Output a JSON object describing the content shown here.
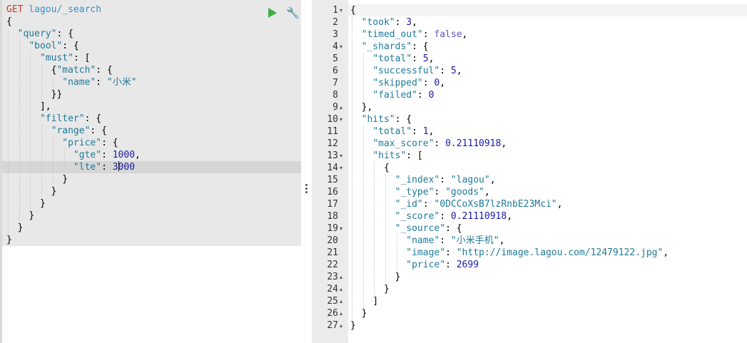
{
  "request": {
    "method": "GET",
    "path": "lagou/_search",
    "lines": [
      {
        "indent": 0,
        "tokens": [
          [
            "pun",
            "{"
          ]
        ]
      },
      {
        "indent": 1,
        "tokens": [
          [
            "key",
            "\"query\""
          ],
          [
            "pun",
            ": {"
          ]
        ]
      },
      {
        "indent": 2,
        "tokens": [
          [
            "key",
            "\"bool\""
          ],
          [
            "pun",
            ": {"
          ]
        ]
      },
      {
        "indent": 3,
        "tokens": [
          [
            "key",
            "\"must\""
          ],
          [
            "pun",
            ": ["
          ]
        ]
      },
      {
        "indent": 4,
        "tokens": [
          [
            "pun",
            "{"
          ],
          [
            "key",
            "\"match\""
          ],
          [
            "pun",
            ": {"
          ]
        ]
      },
      {
        "indent": 5,
        "tokens": [
          [
            "key",
            "\"name\""
          ],
          [
            "pun",
            ": "
          ],
          [
            "str",
            "\"小米\""
          ]
        ]
      },
      {
        "indent": 4,
        "tokens": [
          [
            "pun",
            "}}"
          ]
        ]
      },
      {
        "indent": 3,
        "tokens": [
          [
            "pun",
            "],"
          ]
        ]
      },
      {
        "indent": 3,
        "tokens": [
          [
            "key",
            "\"filter\""
          ],
          [
            "pun",
            ": {"
          ]
        ]
      },
      {
        "indent": 4,
        "tokens": [
          [
            "key",
            "\"range\""
          ],
          [
            "pun",
            ": {"
          ]
        ]
      },
      {
        "indent": 5,
        "tokens": [
          [
            "key",
            "\"price\""
          ],
          [
            "pun",
            ": {"
          ]
        ]
      },
      {
        "indent": 6,
        "tokens": [
          [
            "key",
            "\"gte\""
          ],
          [
            "pun",
            ": "
          ],
          [
            "num",
            "1000"
          ],
          [
            "pun",
            ","
          ]
        ]
      },
      {
        "indent": 6,
        "tokens": [
          [
            "key",
            "\"lte\""
          ],
          [
            "pun",
            ": "
          ],
          [
            "num",
            "3"
          ],
          [
            "caret",
            ""
          ],
          [
            "num",
            "000"
          ]
        ],
        "active": true
      },
      {
        "indent": 5,
        "tokens": [
          [
            "pun",
            "}"
          ]
        ]
      },
      {
        "indent": 4,
        "tokens": [
          [
            "pun",
            "}"
          ]
        ]
      },
      {
        "indent": 3,
        "tokens": [
          [
            "pun",
            "}"
          ]
        ]
      },
      {
        "indent": 2,
        "tokens": [
          [
            "pun",
            "}"
          ]
        ]
      },
      {
        "indent": 1,
        "tokens": [
          [
            "pun",
            "}"
          ]
        ]
      },
      {
        "indent": 0,
        "tokens": [
          [
            "pun",
            "}"
          ]
        ]
      }
    ]
  },
  "toolbar": {
    "run_icon": "play-icon",
    "settings_icon": "wrench-icon",
    "wrench_glyph": "🔧"
  },
  "response": {
    "lines": [
      {
        "n": "1",
        "fold": "▾",
        "indent": 0,
        "tokens": [
          [
            "pun",
            "{"
          ]
        ]
      },
      {
        "n": "2",
        "fold": "",
        "indent": 1,
        "tokens": [
          [
            "key",
            "\"took\""
          ],
          [
            "pun",
            ": "
          ],
          [
            "num",
            "3"
          ],
          [
            "pun",
            ","
          ]
        ]
      },
      {
        "n": "3",
        "fold": "",
        "indent": 1,
        "tokens": [
          [
            "key",
            "\"timed_out\""
          ],
          [
            "pun",
            ": "
          ],
          [
            "bool",
            "false"
          ],
          [
            "pun",
            ","
          ]
        ]
      },
      {
        "n": "4",
        "fold": "▾",
        "indent": 1,
        "tokens": [
          [
            "key",
            "\"_shards\""
          ],
          [
            "pun",
            ": {"
          ]
        ]
      },
      {
        "n": "5",
        "fold": "",
        "indent": 2,
        "tokens": [
          [
            "key",
            "\"total\""
          ],
          [
            "pun",
            ": "
          ],
          [
            "num",
            "5"
          ],
          [
            "pun",
            ","
          ]
        ]
      },
      {
        "n": "6",
        "fold": "",
        "indent": 2,
        "tokens": [
          [
            "key",
            "\"successful\""
          ],
          [
            "pun",
            ": "
          ],
          [
            "num",
            "5"
          ],
          [
            "pun",
            ","
          ]
        ]
      },
      {
        "n": "7",
        "fold": "",
        "indent": 2,
        "tokens": [
          [
            "key",
            "\"skipped\""
          ],
          [
            "pun",
            ": "
          ],
          [
            "num",
            "0"
          ],
          [
            "pun",
            ","
          ]
        ]
      },
      {
        "n": "8",
        "fold": "",
        "indent": 2,
        "tokens": [
          [
            "key",
            "\"failed\""
          ],
          [
            "pun",
            ": "
          ],
          [
            "num",
            "0"
          ]
        ]
      },
      {
        "n": "9",
        "fold": "▴",
        "indent": 1,
        "tokens": [
          [
            "pun",
            "},"
          ]
        ]
      },
      {
        "n": "10",
        "fold": "▾",
        "indent": 1,
        "tokens": [
          [
            "key",
            "\"hits\""
          ],
          [
            "pun",
            ": {"
          ]
        ]
      },
      {
        "n": "11",
        "fold": "",
        "indent": 2,
        "tokens": [
          [
            "key",
            "\"total\""
          ],
          [
            "pun",
            ": "
          ],
          [
            "num",
            "1"
          ],
          [
            "pun",
            ","
          ]
        ]
      },
      {
        "n": "12",
        "fold": "",
        "indent": 2,
        "tokens": [
          [
            "key",
            "\"max_score\""
          ],
          [
            "pun",
            ": "
          ],
          [
            "num",
            "0.21110918"
          ],
          [
            "pun",
            ","
          ]
        ]
      },
      {
        "n": "13",
        "fold": "▾",
        "indent": 2,
        "tokens": [
          [
            "key",
            "\"hits\""
          ],
          [
            "pun",
            ": ["
          ]
        ]
      },
      {
        "n": "14",
        "fold": "▾",
        "indent": 3,
        "tokens": [
          [
            "pun",
            "{"
          ]
        ]
      },
      {
        "n": "15",
        "fold": "",
        "indent": 4,
        "tokens": [
          [
            "key",
            "\"_index\""
          ],
          [
            "pun",
            ": "
          ],
          [
            "str",
            "\"lagou\""
          ],
          [
            "pun",
            ","
          ]
        ]
      },
      {
        "n": "16",
        "fold": "",
        "indent": 4,
        "tokens": [
          [
            "key",
            "\"_type\""
          ],
          [
            "pun",
            ": "
          ],
          [
            "str",
            "\"goods\""
          ],
          [
            "pun",
            ","
          ]
        ]
      },
      {
        "n": "17",
        "fold": "",
        "indent": 4,
        "tokens": [
          [
            "key",
            "\"_id\""
          ],
          [
            "pun",
            ": "
          ],
          [
            "str",
            "\"0DCCoXsB7lzRnbE23Mci\""
          ],
          [
            "pun",
            ","
          ]
        ]
      },
      {
        "n": "18",
        "fold": "",
        "indent": 4,
        "tokens": [
          [
            "key",
            "\"_score\""
          ],
          [
            "pun",
            ": "
          ],
          [
            "num",
            "0.21110918"
          ],
          [
            "pun",
            ","
          ]
        ]
      },
      {
        "n": "19",
        "fold": "▾",
        "indent": 4,
        "tokens": [
          [
            "key",
            "\"_source\""
          ],
          [
            "pun",
            ": {"
          ]
        ]
      },
      {
        "n": "20",
        "fold": "",
        "indent": 5,
        "tokens": [
          [
            "key",
            "\"name\""
          ],
          [
            "pun",
            ": "
          ],
          [
            "str",
            "\"小米手机\""
          ],
          [
            "pun",
            ","
          ]
        ]
      },
      {
        "n": "21",
        "fold": "",
        "indent": 5,
        "tokens": [
          [
            "key",
            "\"image\""
          ],
          [
            "pun",
            ": "
          ],
          [
            "str",
            "\"http://image.lagou.com/12479122.jpg\""
          ],
          [
            "pun",
            ","
          ]
        ]
      },
      {
        "n": "22",
        "fold": "",
        "indent": 5,
        "tokens": [
          [
            "key",
            "\"price\""
          ],
          [
            "pun",
            ": "
          ],
          [
            "num",
            "2699"
          ]
        ]
      },
      {
        "n": "23",
        "fold": "▴",
        "indent": 4,
        "tokens": [
          [
            "pun",
            "}"
          ]
        ]
      },
      {
        "n": "24",
        "fold": "▴",
        "indent": 3,
        "tokens": [
          [
            "pun",
            "}"
          ]
        ]
      },
      {
        "n": "25",
        "fold": "▴",
        "indent": 2,
        "tokens": [
          [
            "pun",
            "]"
          ]
        ]
      },
      {
        "n": "26",
        "fold": "▴",
        "indent": 1,
        "tokens": [
          [
            "pun",
            "}"
          ]
        ]
      },
      {
        "n": "27",
        "fold": "▴",
        "indent": 0,
        "tokens": [
          [
            "pun",
            "}"
          ]
        ]
      }
    ]
  }
}
